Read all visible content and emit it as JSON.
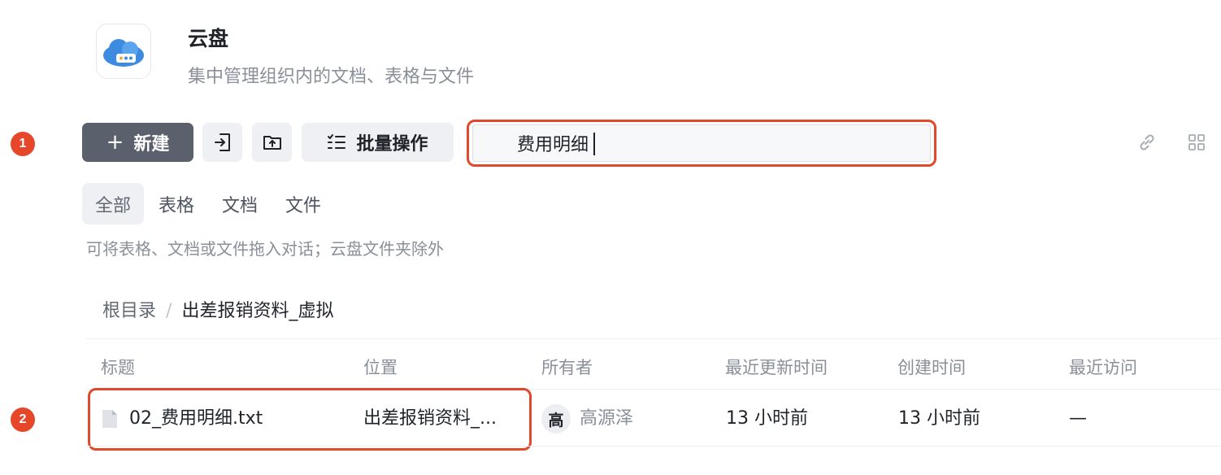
{
  "app": {
    "title": "云盘",
    "subtitle": "集中管理组织内的文档、表格与文件",
    "icon": "cloud-drive-icon"
  },
  "markers": [
    "1",
    "2"
  ],
  "toolbar": {
    "new_label": "新建",
    "new_icon": "plus-icon",
    "import_icon": "import-icon",
    "upload_icon": "upload-folder-icon",
    "batch_label": "批量操作",
    "batch_icon": "checklist-icon",
    "link_icon": "link-icon",
    "grid_icon": "grid-view-icon"
  },
  "search": {
    "value": "费用明细"
  },
  "filters": [
    "全部",
    "表格",
    "文档",
    "文件"
  ],
  "hint": "可将表格、文档或文件拖入对话；云盘文件夹除外",
  "breadcrumb": {
    "root": "根目录",
    "separator": "/",
    "current": "出差报销资料_虚拟"
  },
  "table": {
    "headers": [
      "标题",
      "位置",
      "所有者",
      "最近更新时间",
      "创建时间",
      "最近访问"
    ],
    "rows": [
      {
        "title": "02_费用明细.txt",
        "location": "出差报销资料_...",
        "owner_initial": "高",
        "owner_name": "高源泽",
        "updated": "13 小时前",
        "created": "13 小时前",
        "visited": "—"
      }
    ]
  },
  "colors": {
    "primary_button": "#5b606d",
    "highlight": "#e0492c",
    "marker": "#e6462a",
    "secondary_bg": "#eef0f3"
  }
}
